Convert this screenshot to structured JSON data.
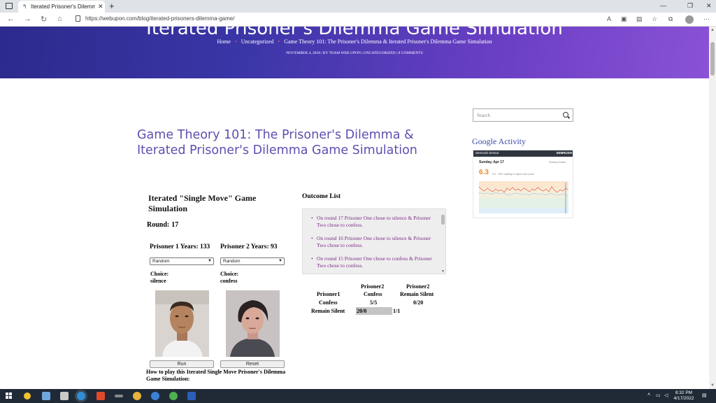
{
  "browser": {
    "tab_title": "Iterated Prisoner's Dilemma Gam",
    "url": "https://webupon.com/blog/iterated-prisoners-dilemma-game/"
  },
  "hero": {
    "title": "Iterated Prisoner's Dilemma Game Simulation",
    "breadcrumbs": [
      "Home",
      "Uncategorized",
      "Game Theory 101: The Prisoner's Dilemma & Iterated Prisoner's Dilemma Game Simulation"
    ],
    "meta": "NOVEMBER 4, 2018 | BY TEAM WEB UPON | UNCATEGORIZED | 8 COMMENTS"
  },
  "post": {
    "title": "Game Theory 101: The Prisoner's Dilemma & Iterated Prisoner's Dilemma Game Simulation"
  },
  "simulation": {
    "title": "Iterated \"Single Move\" Game Simulation",
    "round_label": "Round:",
    "round_value": "17",
    "p1_years": "Prisoner 1 Years: 133",
    "p2_years": "Prisoner 2 Years: 93",
    "p1_strategy": "Random",
    "p2_strategy": "Random",
    "choice_label": "Choice:",
    "p1_choice": "silence",
    "p2_choice": "confess",
    "run_label": "Run",
    "reset_label": "Reset",
    "howto": "How to play this Iterated Single Move Prisoner's Dilemma Game Simulation:"
  },
  "outcome": {
    "heading": "Outcome List",
    "items": [
      "On round 17 Prisoner One chose to silence & Prisoner Two chose to confess.",
      "On round 16 Prisoner One chose to silence & Prisoner Two chose to confess.",
      "On round 15 Prisoner One chose to confess & Prisoner Two chose to confess."
    ]
  },
  "payoff": {
    "p2_label": "Prisoner2",
    "p1_label": "Prisoner1",
    "confess": "Confess",
    "remain_silent": "Remain Silent",
    "cc": "5/5",
    "cs": "0/20",
    "sc": "20/0",
    "ss": "1/1"
  },
  "sidebar": {
    "search_placeholder": "Search",
    "ga_title": "Google Activity",
    "ga_header": "Semrush Sensor",
    "ga_brand": "SEMRUSH",
    "ga_date": "Sunday, Apr 17",
    "ga_value": "6.3",
    "ga_legend": "Desktop  Mobile",
    "ga_unit": "/10 · 34% volatility is higher than usual"
  },
  "taskbar": {
    "time": "8:32 PM",
    "date": "4/17/2022"
  },
  "colors": {
    "accent": "#5f4fb0",
    "outcome_text": "#7b2a87",
    "ga_value": "#f08a24"
  }
}
